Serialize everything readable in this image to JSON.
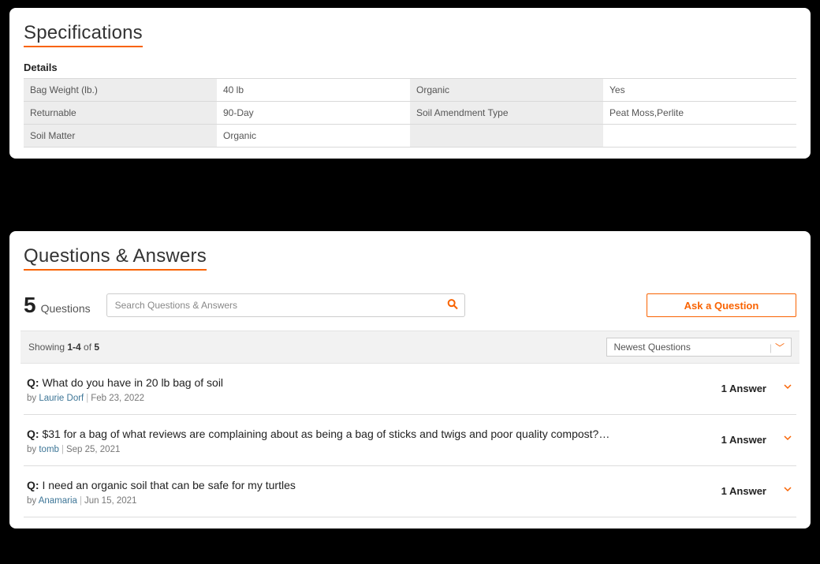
{
  "specifications": {
    "title": "Specifications",
    "details_label": "Details",
    "rows": [
      {
        "k1": "Bag Weight (lb.)",
        "v1": "40 lb",
        "k2": "Organic",
        "v2": "Yes"
      },
      {
        "k1": "Returnable",
        "v1": "90-Day",
        "k2": "Soil Amendment Type",
        "v2": "Peat Moss,Perlite"
      },
      {
        "k1": "Soil Matter",
        "v1": "Organic",
        "k2": "",
        "v2": ""
      }
    ]
  },
  "qa": {
    "title": "Questions & Answers",
    "count": "5",
    "count_label": "Questions",
    "search_placeholder": "Search Questions & Answers",
    "ask_button": "Ask a Question",
    "showing_prefix": "Showing ",
    "showing_range": "1-4",
    "showing_mid": " of ",
    "showing_total": "5",
    "sort_label": "Newest Questions",
    "q_prefix": "Q:",
    "by_label": "by",
    "questions": [
      {
        "text": " What do you have in 20 lb bag of soil",
        "author": "Laurie Dorf",
        "date": "Feb 23, 2022",
        "answers": "1 Answer"
      },
      {
        "text": " $31 for a bag of what reviews are complaining about as being a bag of sticks and twigs and poor quality compost?…",
        "author": "tomb",
        "date": "Sep 25, 2021",
        "answers": "1 Answer"
      },
      {
        "text": " I need an organic soil that can be safe for my turtles",
        "author": "Anamaria",
        "date": "Jun 15, 2021",
        "answers": "1 Answer"
      }
    ]
  }
}
